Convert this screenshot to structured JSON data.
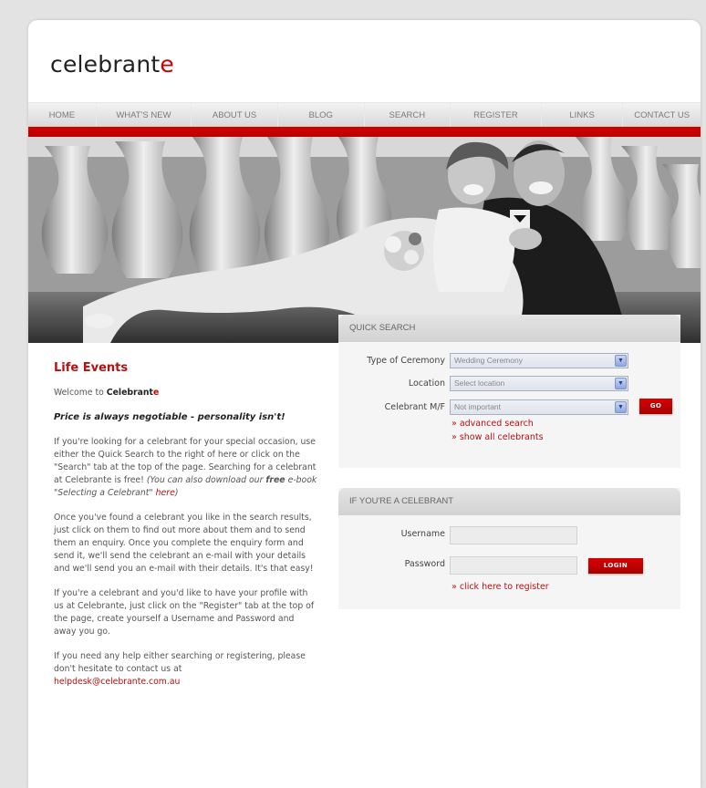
{
  "brand": {
    "name_main": "celebrant",
    "name_accent": "e"
  },
  "nav": [
    "HOME",
    "WHAT'S NEW",
    "ABOUT US",
    "BLOG",
    "SEARCH",
    "REGISTER",
    "LINKS",
    "CONTACT US"
  ],
  "content": {
    "heading": "Life Events",
    "welcome_prefix": "Welcome to ",
    "welcome_brand": "Celebrant",
    "welcome_brand_accent": "e",
    "tagline": "Price is always negotiable - personality isn't!",
    "p1_text": "If you're looking for a celebrant for your special occasion, use either the Quick Search to the right of here or click on the \"Search\" tab at the top of the page. Searching for a celebrant at Celebrante is free! ",
    "p1_italic_a": "(You can also download our ",
    "p1_italic_bold": "free",
    "p1_italic_b": " e-book \"Selecting a Celebrant\" ",
    "p1_link": "here",
    "p1_italic_c": ")",
    "p2": "Once you've found a celebrant you like in the search results, just click on them to find out more about them and to send them an enquiry. Once you complete the enquiry form and send it, we'll send the celebrant an e-mail with your details and we'll send you an e-mail with their details. It's that easy!",
    "p3": "If you're a celebrant and you'd like to have your profile with us at Celebrante, just click on the \"Register\" tab at the top of the page, create yourself a Username and Password and away you go.",
    "p4": "If you need any help either searching or registering, please don't hesitate to contact us at",
    "email": "helpdesk@celebrante.com.au"
  },
  "quick_search": {
    "title": "QUICK SEARCH",
    "type_label": "Type of Ceremony",
    "type_value": "Wedding Ceremony",
    "location_label": "Location",
    "location_value": "Select location",
    "gender_label": "Celebrant M/F",
    "gender_value": "Not important",
    "go_label": "GO",
    "advanced_link": "» advanced search",
    "show_all_link": "» show all celebrants"
  },
  "celebrant_login": {
    "title": "IF YOU'RE A CELEBRANT",
    "username_label": "Username",
    "password_label": "Password",
    "login_label": "LOGIN",
    "register_link": "» click here to register"
  },
  "colors": {
    "accent": "#cc0000",
    "nav_bg": "#e0e0e0",
    "panel_bg": "#f5f5f5"
  }
}
